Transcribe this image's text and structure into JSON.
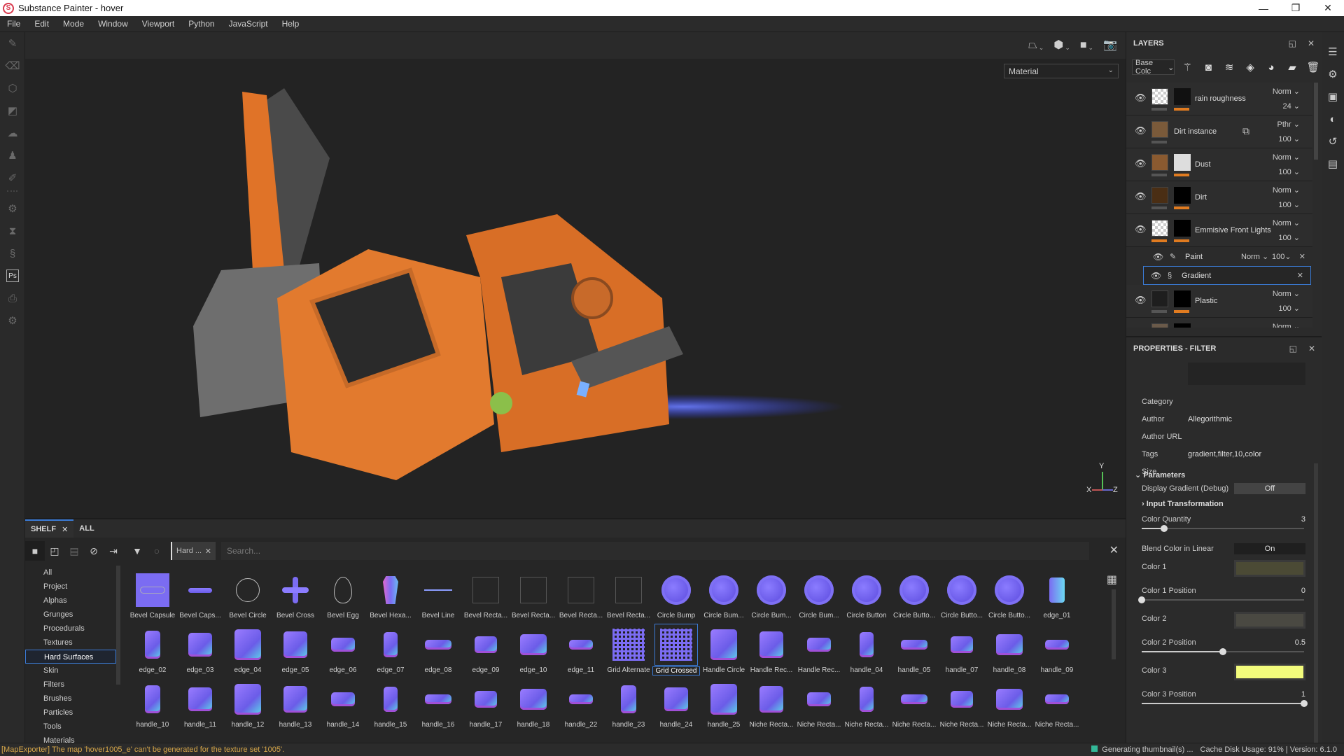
{
  "window": {
    "title": "Substance Painter - hover",
    "minimize": "—",
    "restore": "❐",
    "close": "✕"
  },
  "menu": [
    "File",
    "Edit",
    "Mode",
    "Window",
    "Viewport",
    "Python",
    "JavaScript",
    "Help"
  ],
  "left_tools": [
    {
      "name": "paint-brush-icon",
      "glyph": "✎"
    },
    {
      "name": "eraser-icon",
      "glyph": "⌫"
    },
    {
      "name": "projection-icon",
      "glyph": "⬡"
    },
    {
      "name": "polygon-fill-icon",
      "glyph": "◩"
    },
    {
      "name": "smudge-icon",
      "glyph": "☁"
    },
    {
      "name": "clone-stamp-icon",
      "glyph": "♟"
    },
    {
      "name": "color-picker-icon",
      "glyph": "✐"
    },
    {
      "name": "bake-icon",
      "glyph": "⚙"
    },
    {
      "name": "hourglass-icon",
      "glyph": "⧗"
    },
    {
      "name": "substance-icon",
      "glyph": "§"
    },
    {
      "name": "photoshop-icon",
      "glyph": "Ps"
    },
    {
      "name": "export-icon",
      "glyph": "⎙"
    },
    {
      "name": "settings-icon",
      "glyph": "⚙"
    }
  ],
  "viewport": {
    "mode_select": "Material",
    "mode_chevron": "⌄",
    "toolbar": [
      {
        "name": "perspective-icon",
        "glyph": "⏢"
      },
      {
        "name": "cube-view-icon",
        "glyph": "⬢"
      },
      {
        "name": "camera-icon",
        "glyph": "■"
      },
      {
        "name": "screenshot-icon",
        "glyph": "📷"
      }
    ],
    "gizmo": {
      "x": "X",
      "y": "Y",
      "z": "Z"
    }
  },
  "shelf": {
    "tabs": [
      {
        "label": "SHELF",
        "close": "✕"
      },
      {
        "label": "ALL"
      }
    ],
    "filter_chip": "Hard ...",
    "filter_chip_close": "✕",
    "search_placeholder": "Search...",
    "close": "✕",
    "categories": [
      "All",
      "Project",
      "Alphas",
      "Grunges",
      "Procedurals",
      "Textures",
      "Hard Surfaces",
      "Skin",
      "Filters",
      "Brushes",
      "Particles",
      "Tools",
      "Materials"
    ],
    "selected_category": "Hard Surfaces",
    "items": [
      "Bevel Capsule",
      "Bevel Caps...",
      "Bevel Circle",
      "Bevel Cross",
      "Bevel Egg",
      "Bevel Hexa...",
      "Bevel Line",
      "Bevel Recta...",
      "Bevel Recta...",
      "Bevel Recta...",
      "Bevel Recta...",
      "Circle Bump",
      "Circle Bum...",
      "Circle Bum...",
      "Circle Bum...",
      "Circle Button",
      "Circle Butto...",
      "Circle Butto...",
      "Circle Butto...",
      "edge_01",
      "edge_02",
      "edge_03",
      "edge_04",
      "edge_05",
      "edge_06",
      "edge_07",
      "edge_08",
      "edge_09",
      "edge_10",
      "edge_11",
      "Grid Alternate",
      "Grid Crossed",
      "Handle Circle",
      "Handle Rec...",
      "Handle Rec...",
      "handle_04",
      "handle_05",
      "handle_07",
      "handle_08",
      "handle_09",
      "handle_10",
      "handle_11",
      "handle_12",
      "handle_13",
      "handle_14",
      "handle_15",
      "handle_16",
      "handle_17",
      "handle_18",
      "handle_22",
      "handle_23",
      "handle_24",
      "handle_25",
      "Niche Recta...",
      "Niche Recta...",
      "Niche Recta...",
      "Niche Recta...",
      "Niche Recta...",
      "Niche Recta...",
      "Niche Recta..."
    ],
    "selected_item": "Grid Crossed"
  },
  "layers": {
    "title": "LAYERS",
    "channel": "Base Colc",
    "rows": [
      {
        "name": "rain roughness",
        "blend": "Norm",
        "opacity": "24"
      },
      {
        "name": "Dirt instance",
        "blend": "Pthr",
        "opacity": "100"
      },
      {
        "name": "Dust",
        "blend": "Norm",
        "opacity": "100"
      },
      {
        "name": "Dirt",
        "blend": "Norm",
        "opacity": "100"
      },
      {
        "name": "Emmisive Front Lights",
        "blend": "Norm",
        "opacity": "100"
      }
    ],
    "effects": [
      {
        "name": "Paint",
        "blend": "Norm",
        "opacity": "100"
      },
      {
        "name": "Gradient"
      }
    ],
    "rows2": [
      {
        "name": "Plastic",
        "blend": "Norm",
        "opacity": "100"
      },
      {
        "name": "",
        "blend": "Norm",
        "opacity": ""
      }
    ]
  },
  "properties": {
    "title": "PROPERTIES - FILTER",
    "info": [
      {
        "label": "Category",
        "value": ""
      },
      {
        "label": "Author",
        "value": "Allegorithmic"
      },
      {
        "label": "Author URL",
        "value": ""
      },
      {
        "label": "Tags",
        "value": "gradient,filter,10,color"
      },
      {
        "label": "Size",
        "value": ""
      }
    ],
    "parameters_label": "Parameters",
    "display_gradient": {
      "label": "Display Gradient (Debug)",
      "value": "Off"
    },
    "input_transformation": "Input Transformation",
    "color_quantity": {
      "label": "Color Quantity",
      "value": "3",
      "fraction": 0.14
    },
    "blend_linear": {
      "label": "Blend Color in Linear",
      "value": "On"
    },
    "color1": {
      "label": "Color 1",
      "hex": "#4b4a35"
    },
    "color1_pos": {
      "label": "Color 1 Position",
      "value": "0",
      "fraction": 0
    },
    "color2": {
      "label": "Color 2",
      "hex": "#4a4942"
    },
    "color2_pos": {
      "label": "Color 2 Position",
      "value": "0.5",
      "fraction": 0.5
    },
    "color3": {
      "label": "Color 3",
      "hex": "#f3fc7c"
    },
    "color3_pos": {
      "label": "Color 3 Position",
      "value": "1",
      "fraction": 1
    }
  },
  "side_strip": [
    {
      "name": "layers-list-icon",
      "glyph": "☰"
    },
    {
      "name": "texture-set-settings-icon",
      "glyph": "⚙"
    },
    {
      "name": "display-settings-icon",
      "glyph": "▣"
    },
    {
      "name": "shader-settings-icon",
      "glyph": "◐"
    },
    {
      "name": "history-icon",
      "glyph": "↺"
    },
    {
      "name": "log-icon",
      "glyph": "▤"
    }
  ],
  "status": {
    "error": "[MapExporter] The map 'hover1005_e' can't be generated for the texture set '1005'.",
    "progress": "Generating thumbnail(s) ...",
    "cache": "Cache Disk Usage:   91% | Version: 6.1.0"
  },
  "colors": {
    "accent": "#3b7bd6",
    "layer_mask_bar": "#e07b20",
    "status_ok": "#33b898",
    "warning_text": "#d8a84a"
  }
}
